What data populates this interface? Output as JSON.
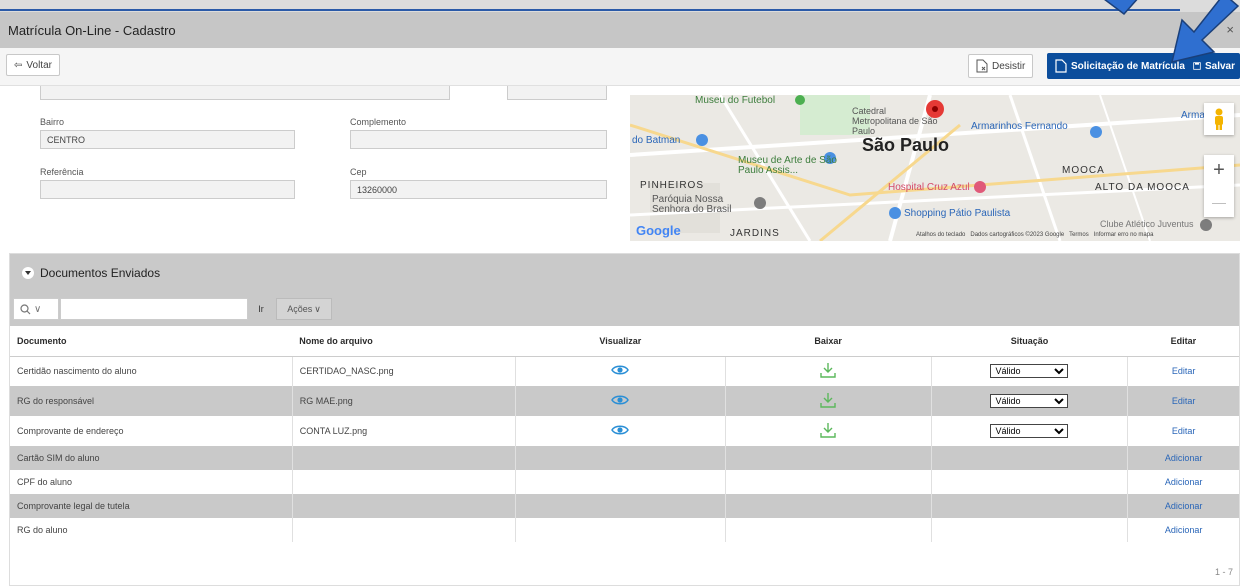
{
  "window": {
    "title": "Matrícula On-Line - Cadastro",
    "close": "×"
  },
  "toolbar": {
    "back_label": "Voltar",
    "desistir_label": "Desistir",
    "solicitacao_label": "Solicitação de Matrícula",
    "salvar_label": "Salvar"
  },
  "form": {
    "bairro_label": "Bairro",
    "bairro_value": "CENTRO",
    "complemento_label": "Complemento",
    "complemento_value": "",
    "referencia_label": "Referência",
    "referencia_value": "",
    "cep_label": "Cep",
    "cep_value": "13260000"
  },
  "map": {
    "labels": {
      "museu_futebol": "Museu do Futebol",
      "catedral": "Catedral Metropolitana de São Paulo",
      "armarinhos": "Armarinhos Fernando",
      "armari": "Armari",
      "batman": "do Batman",
      "sao_paulo": "São Paulo",
      "masp": "Museu de Arte de São Paulo Assis...",
      "mooca": "MOOCA",
      "pinheiros": "PINHEIROS",
      "hospital": "Hospital Cruz Azul",
      "alto_mooca": "ALTO DA MOOCA",
      "paroquia": "Paróquia Nossa Senhora do Brasil",
      "shopping": "Shopping Pátio Paulista",
      "jardins": "JARDINS",
      "clube": "Clube Atlético Juventus",
      "google": "Google",
      "attribution": "Atalhos do teclado   Dados cartográficos ©2023 Google   Termos   Informar erro no mapa"
    },
    "zoom_in": "+",
    "zoom_out": "—"
  },
  "documents": {
    "section_title": "Documentos Enviados",
    "search_label": "Q∨",
    "ir_label": "Ir",
    "acoes_label": "Ações",
    "columns": [
      "Documento",
      "Nome do arquivo",
      "Visualizar",
      "Baixar",
      "Situação",
      "Editar"
    ],
    "rows": [
      {
        "documento": "Certidão nascimento do aluno",
        "arquivo": "CERTIDAO_NASC.png",
        "situacao": "Válido",
        "acao": "Editar"
      },
      {
        "documento": "RG do responsável",
        "arquivo": "RG MAE.png",
        "situacao": "Válido",
        "acao": "Editar"
      },
      {
        "documento": "Comprovante de endereço",
        "arquivo": "CONTA LUZ.png",
        "situacao": "Válido",
        "acao": "Editar"
      },
      {
        "documento": "Cartão SIM do aluno",
        "arquivo": "",
        "situacao": "",
        "acao": "Adicionar"
      },
      {
        "documento": "CPF do aluno",
        "arquivo": "",
        "situacao": "",
        "acao": "Adicionar"
      },
      {
        "documento": "Comprovante legal de tutela",
        "arquivo": "",
        "situacao": "",
        "acao": "Adicionar"
      },
      {
        "documento": "RG do aluno",
        "arquivo": "",
        "situacao": "",
        "acao": "Adicionar"
      }
    ],
    "pagination": "1 - 7"
  },
  "colors": {
    "primary": "#0b4d9c",
    "header_gray": "#c9c9c9",
    "link": "#2a66b8",
    "icon": "#2a8fd6",
    "download": "#5cb85c"
  }
}
